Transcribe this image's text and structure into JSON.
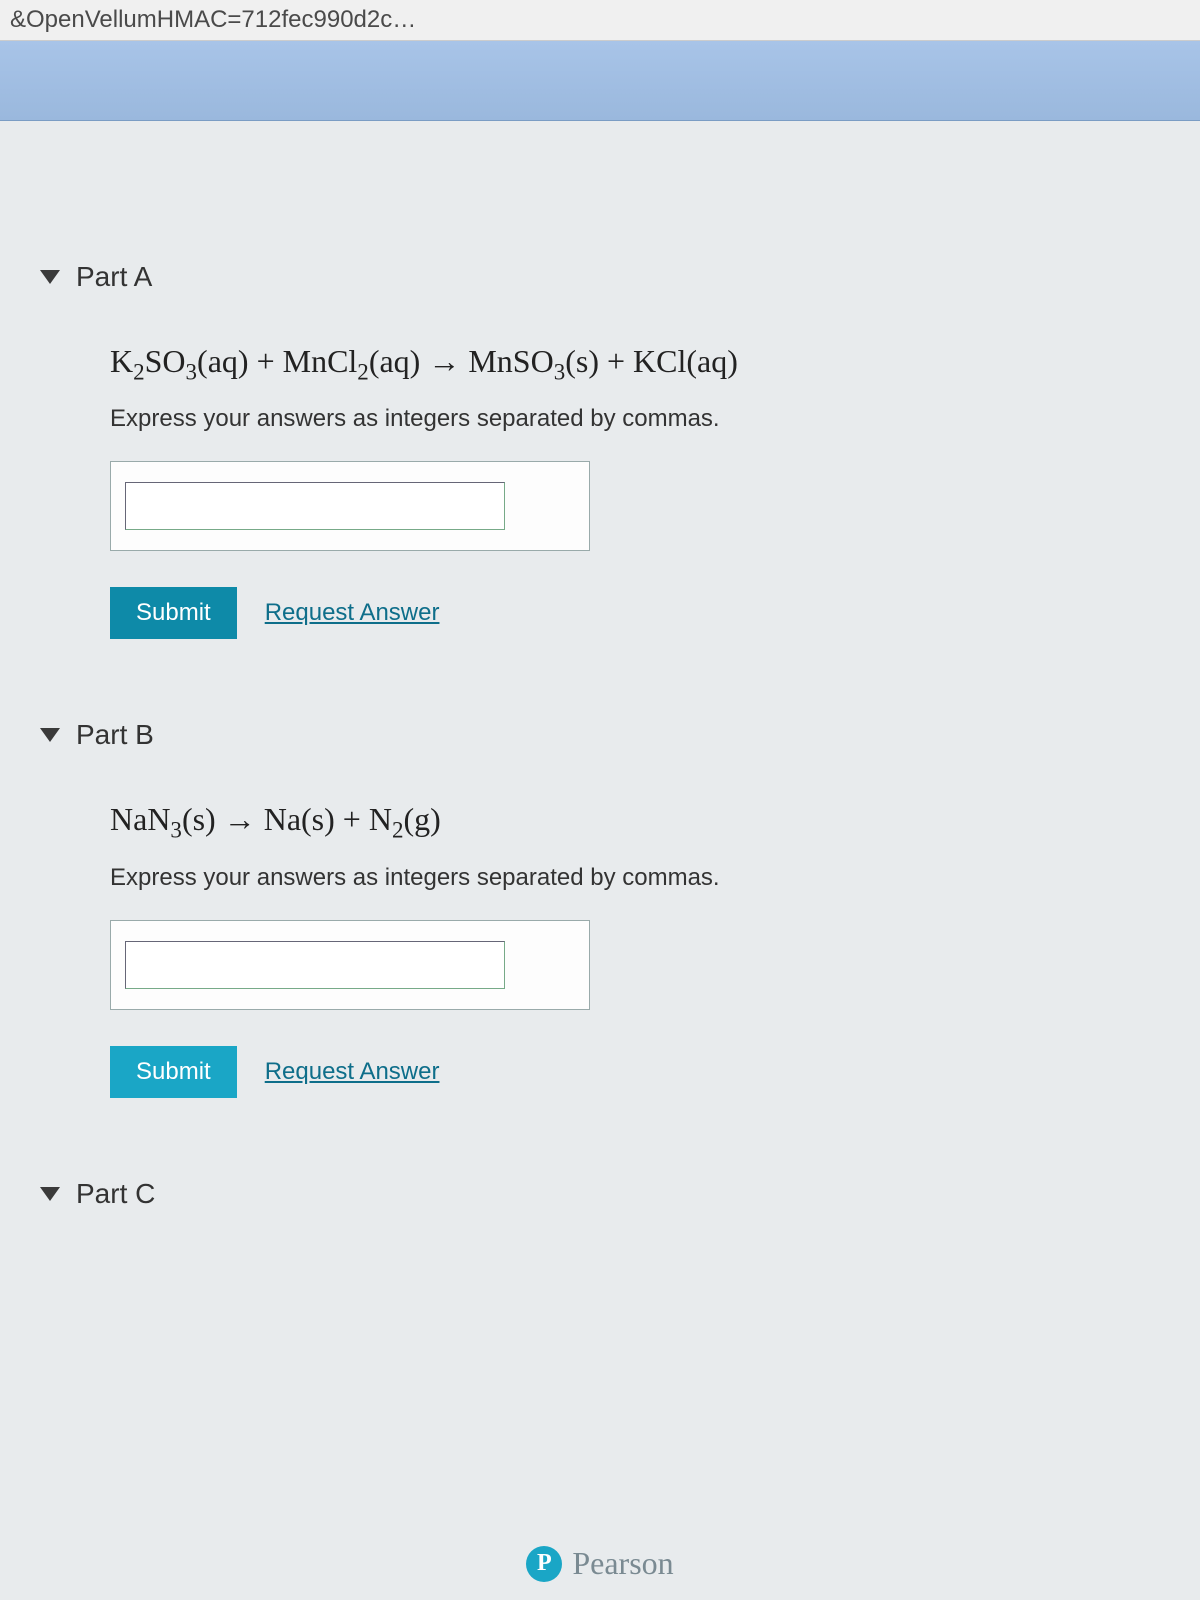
{
  "url_fragment": "&OpenVellumHMAC=712fec990d2c…",
  "parts": {
    "a": {
      "title": "Part A",
      "equation_html": "K<sub>2</sub>SO<sub>3</sub>(aq) + MnCl<sub>2</sub>(aq) → MnSO<sub>3</sub>(s) + KCl(aq)",
      "instruction": "Express your answers as integers separated by commas.",
      "submit_label": "Submit",
      "request_label": "Request Answer",
      "input_value": ""
    },
    "b": {
      "title": "Part B",
      "equation_html": "NaN<sub>3</sub>(s) → Na(s) + N<sub>2</sub>(g)",
      "instruction": "Express your answers as integers separated by commas.",
      "submit_label": "Submit",
      "request_label": "Request Answer",
      "input_value": ""
    },
    "c": {
      "title": "Part C"
    }
  },
  "footer": {
    "logo_letter": "P",
    "brand": "Pearson"
  }
}
